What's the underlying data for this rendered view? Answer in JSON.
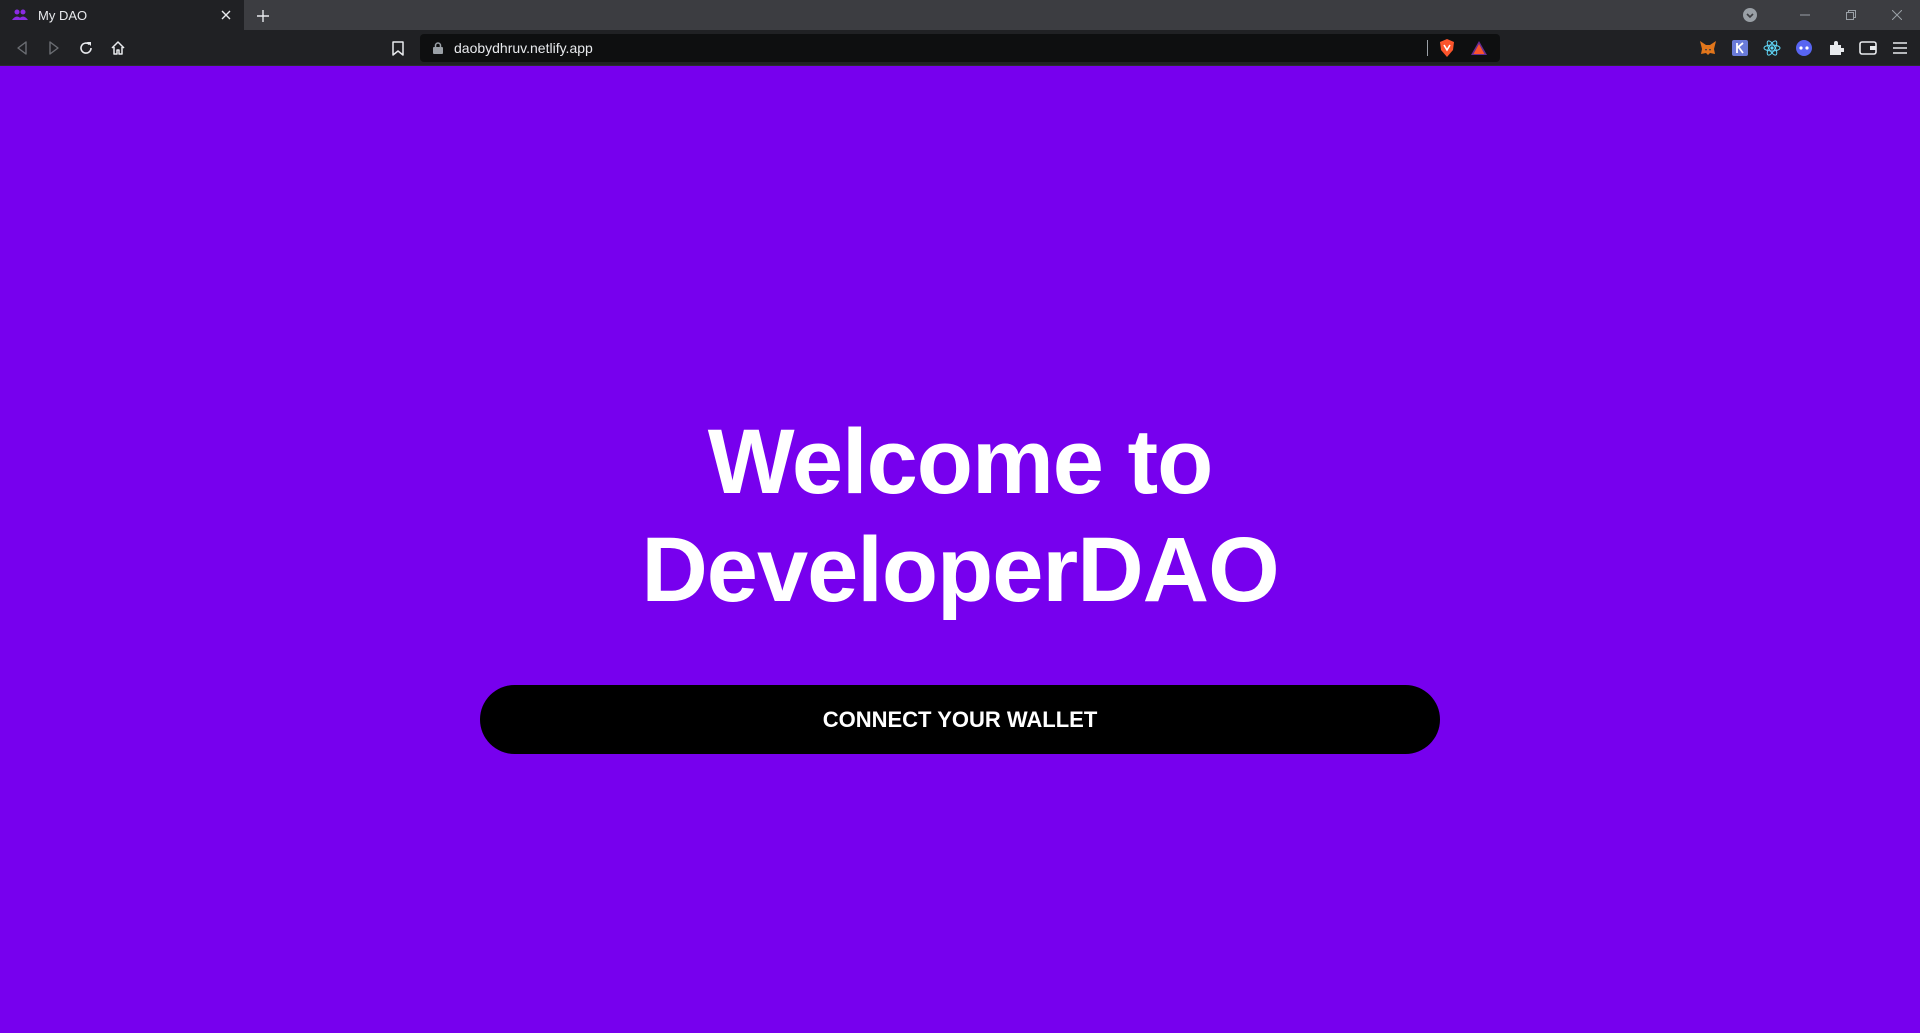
{
  "browser": {
    "tab": {
      "title": "My DAO",
      "favicon": "people-group-icon",
      "favicon_color": "#7700ee"
    },
    "url": "daobydhruv.netlify.app",
    "extensions": [
      "metamask-fox-icon",
      "k-extension-icon",
      "react-devtools-icon",
      "gamepad-extension-icon",
      "puzzle-extensions-icon",
      "wallet-icon",
      "menu-icon"
    ]
  },
  "page": {
    "background_color": "#7700ee",
    "title_line1": "Welcome to",
    "title_line2": "DeveloperDAO",
    "button_label": "CONNECT YOUR WALLET",
    "button_color": "#000000"
  }
}
